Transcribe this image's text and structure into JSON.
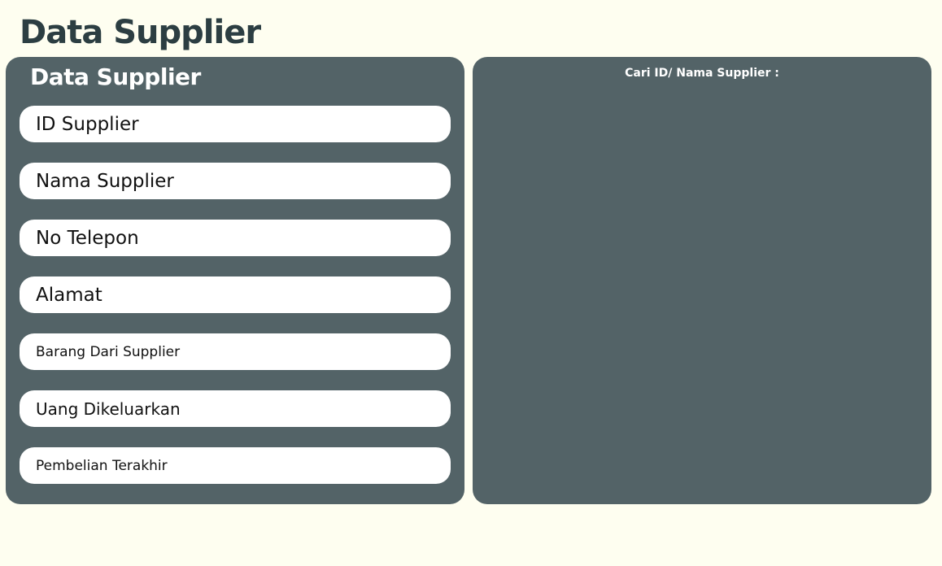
{
  "header": {
    "title": "Data Supplier"
  },
  "form_panel": {
    "title": "Data Supplier",
    "fields": [
      {
        "label": "ID Supplier"
      },
      {
        "label": "Nama Supplier"
      },
      {
        "label": "No Telepon"
      },
      {
        "label": "Alamat"
      },
      {
        "label": "Barang Dari Supplier"
      },
      {
        "label": "Uang Dikeluarkan"
      },
      {
        "label": "Pembelian Terakhir"
      }
    ]
  },
  "search_panel": {
    "label": "Cari ID/ Nama Supplier :"
  },
  "colors": {
    "background": "#fefef0",
    "panel": "#536367",
    "title": "#2c3e42",
    "field": "#ffffff"
  }
}
